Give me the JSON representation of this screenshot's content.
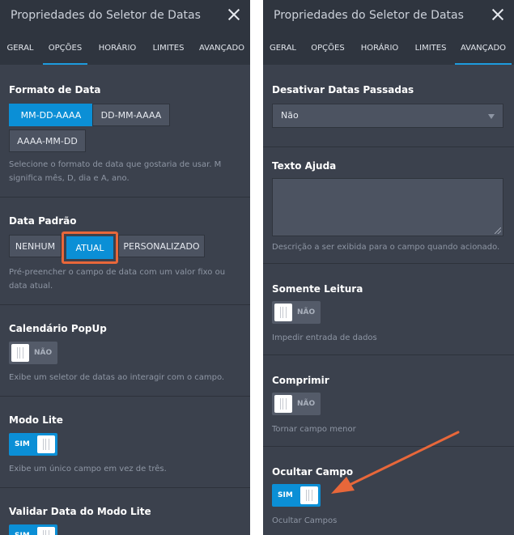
{
  "left": {
    "title": "Propriedades do Seletor de Datas",
    "tabs": [
      "GERAL",
      "OPÇÕES",
      "HORÁRIO",
      "LIMITES",
      "AVANÇADO"
    ],
    "active_tab": "OPÇÕES",
    "date_format": {
      "label": "Formato de Data",
      "options": [
        "MM-DD-AAAA",
        "DD-MM-AAAA",
        "AAAA-MM-DD"
      ],
      "selected": "MM-DD-AAAA",
      "description": "Selecione o formato de data que gostaria de usar. M significa mês, D, dia e A, ano."
    },
    "default_date": {
      "label": "Data Padrão",
      "options": [
        "NENHUM",
        "ATUAL",
        "PERSONALIZADO"
      ],
      "selected": "ATUAL",
      "description": "Pré-preencher o campo de data com um valor fixo ou data atual."
    },
    "popup": {
      "label": "Calendário PopUp",
      "toggle": "NÃO",
      "description": "Exibe um seletor de datas ao interagir com o campo."
    },
    "lite": {
      "label": "Modo Lite",
      "toggle": "SIM",
      "description": "Exibe um único campo em vez de três."
    },
    "validate": {
      "label": "Validar Data do Modo Lite",
      "toggle": "SIM"
    }
  },
  "right": {
    "title": "Propriedades do Seletor de Datas",
    "tabs": [
      "GERAL",
      "OPÇÕES",
      "HORÁRIO",
      "LIMITES",
      "AVANÇADO"
    ],
    "active_tab": "AVANÇADO",
    "disable_past": {
      "label": "Desativar Datas Passadas",
      "value": "Não"
    },
    "help_text": {
      "label": "Texto Ajuda",
      "value": "",
      "description": "Descrição a ser exibida para o campo quando acionado."
    },
    "readonly": {
      "label": "Somente Leitura",
      "toggle": "NÃO",
      "description": "Impedir entrada de dados"
    },
    "compress": {
      "label": "Comprimir",
      "toggle": "NÃO",
      "description": "Tornar campo menor"
    },
    "hide": {
      "label": "Ocultar Campo",
      "toggle": "SIM",
      "description": "Ocultar Campos"
    }
  },
  "colors": {
    "panel_bg": "#3b414d",
    "header_bg": "#2f353f",
    "accent": "#0b8fd6",
    "highlight": "#e8673a"
  }
}
